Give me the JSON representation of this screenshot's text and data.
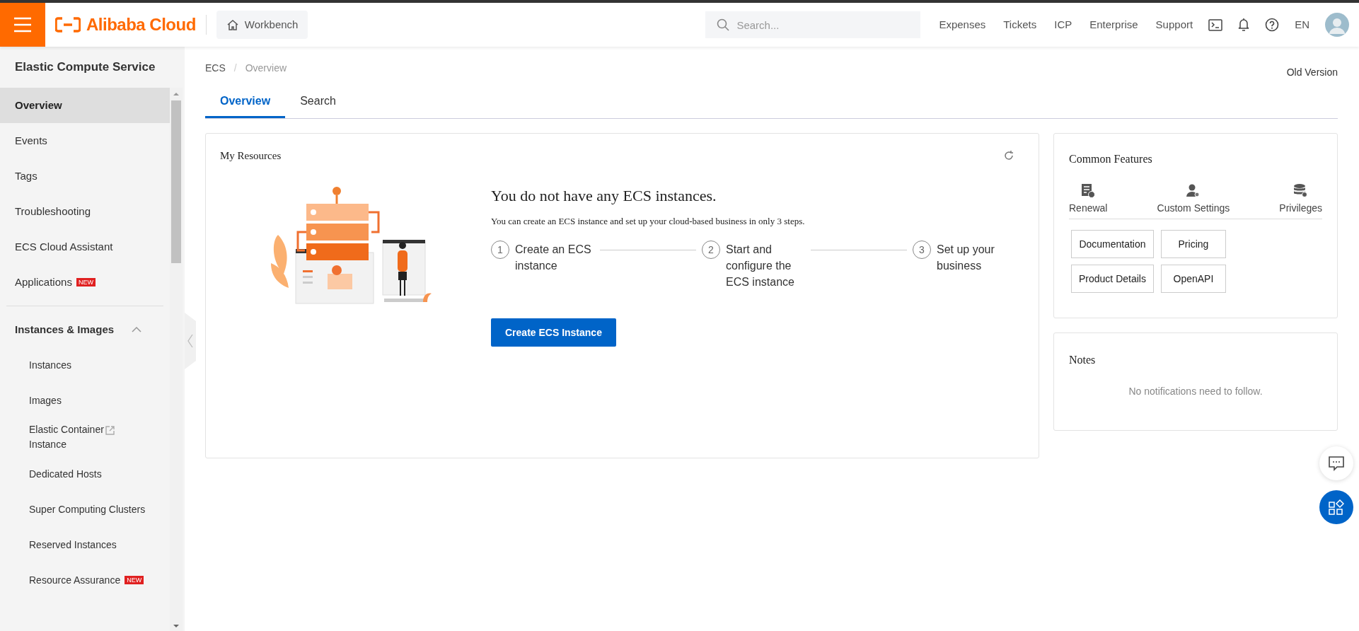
{
  "header": {
    "logo_text": "Alibaba Cloud",
    "workbench": "Workbench",
    "search": {
      "placeholder": "Search..."
    },
    "links": [
      "Expenses",
      "Tickets",
      "ICP",
      "Enterprise",
      "Support"
    ],
    "language": "EN"
  },
  "sidebar": {
    "title": "Elastic Compute Service",
    "items": [
      {
        "label": "Overview",
        "selected": true
      },
      {
        "label": "Events",
        "selected": false
      },
      {
        "label": "Tags",
        "selected": false
      },
      {
        "label": "Troubleshooting",
        "selected": false
      },
      {
        "label": "ECS Cloud Assistant",
        "selected": false
      },
      {
        "label": "Applications",
        "selected": false,
        "badge": "NEW"
      }
    ],
    "groups": [
      {
        "label": "Instances & Images",
        "expanded": true,
        "children": [
          {
            "label": "Instances",
            "selected": false,
            "external": false
          },
          {
            "label": "Images",
            "selected": false,
            "external": false
          },
          {
            "label": "Elastic Container Instance",
            "selected": false,
            "external": true
          },
          {
            "label": "Dedicated Hosts",
            "selected": false,
            "external": false
          },
          {
            "label": "Super Computing Clusters",
            "selected": false,
            "external": false
          },
          {
            "label": "Reserved Instances",
            "selected": false,
            "external": false
          },
          {
            "label": "Resource Assurance",
            "selected": false,
            "external": false,
            "badge": "NEW"
          }
        ]
      }
    ]
  },
  "breadcrumb": [
    "ECS",
    "Overview"
  ],
  "breadcrumb_separator": "/",
  "old_version": "Old Version",
  "tabs": [
    {
      "label": "Overview",
      "selected": true
    },
    {
      "label": "Search",
      "selected": false
    }
  ],
  "my_resources": {
    "title": "My Resources",
    "heading": "You do not have any ECS instances.",
    "subtitle": "You can create an ECS instance and set up your cloud-based business in only 3 steps.",
    "steps": [
      {
        "number": "1",
        "label": "Create an ECS instance"
      },
      {
        "number": "2",
        "label": "Start and configure the ECS instance"
      },
      {
        "number": "3",
        "label": "Set up your business"
      }
    ],
    "button": "Create ECS Instance"
  },
  "common_features": {
    "title": "Common Features",
    "features": [
      {
        "label": "Renewal",
        "kind": "renewal"
      },
      {
        "label": "Custom Settings",
        "kind": "user"
      },
      {
        "label": "Privileges",
        "kind": "database"
      }
    ],
    "links": [
      "Documentation",
      "Pricing",
      "Product Details",
      "OpenAPI"
    ]
  },
  "notes": {
    "title": "Notes",
    "empty": "No notifications need to follow."
  }
}
